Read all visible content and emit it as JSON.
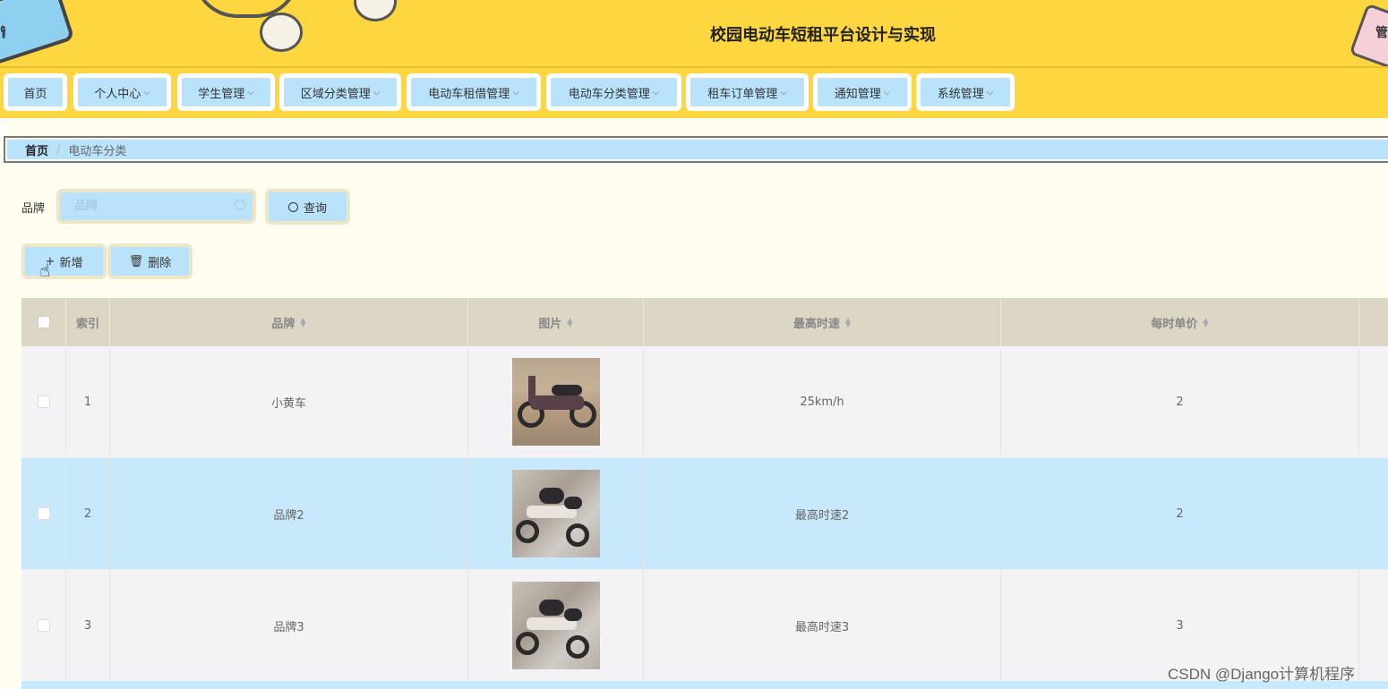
{
  "header": {
    "title": "校园电动车短租平台设计与实现",
    "edge_left_text": "管",
    "edge_right_text": "管"
  },
  "nav": {
    "items": [
      {
        "label": "首页",
        "has_dropdown": false
      },
      {
        "label": "个人中心",
        "has_dropdown": true
      },
      {
        "label": "学生管理",
        "has_dropdown": true
      },
      {
        "label": "区域分类管理",
        "has_dropdown": true
      },
      {
        "label": "电动车租借管理",
        "has_dropdown": true
      },
      {
        "label": "电动车分类管理",
        "has_dropdown": true
      },
      {
        "label": "租车订单管理",
        "has_dropdown": true
      },
      {
        "label": "通知管理",
        "has_dropdown": true
      },
      {
        "label": "系统管理",
        "has_dropdown": true
      }
    ]
  },
  "breadcrumb": {
    "home": "首页",
    "separator": "/",
    "current": "电动车分类"
  },
  "search": {
    "label": "品牌",
    "placeholder": "品牌",
    "value": "",
    "query_button": "查询"
  },
  "actions": {
    "add_button": "新增",
    "delete_button": "删除"
  },
  "table": {
    "columns": {
      "index": "索引",
      "brand": "品牌",
      "image": "图片",
      "max_speed": "最高时速",
      "hourly_price": "每时单价"
    },
    "rows": [
      {
        "index": "1",
        "brand": "小黄车",
        "max_speed": "25km/h",
        "hourly_price": "2"
      },
      {
        "index": "2",
        "brand": "品牌2",
        "max_speed": "最高时速2",
        "hourly_price": "2"
      },
      {
        "index": "3",
        "brand": "品牌3",
        "max_speed": "最高时速3",
        "hourly_price": "3"
      }
    ]
  },
  "watermark": "CSDN @Django计算机程序",
  "colors": {
    "header_bg": "#fdd640",
    "nav_item_bg": "#b9e3fa",
    "table_header_bg": "#dbd7c4",
    "row_highlight": "#c8e9fb",
    "page_bg": "#fffcf0"
  }
}
